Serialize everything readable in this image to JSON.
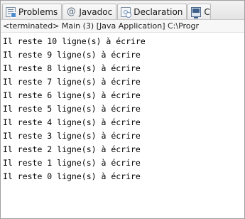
{
  "tabs": [
    {
      "label": "Problems",
      "icon": "problems-icon"
    },
    {
      "label": "Javadoc",
      "icon": "javadoc-icon"
    },
    {
      "label": "Declaration",
      "icon": "declaration-icon"
    },
    {
      "label": "C",
      "icon": "console-icon"
    }
  ],
  "status_text": "<terminated> Main (3) [Java Application] C:\\Progr",
  "console_lines": [
    "Il reste 10 ligne(s) à écrire",
    "Il reste 9 ligne(s) à écrire",
    "Il reste 8 ligne(s) à écrire",
    "Il reste 7 ligne(s) à écrire",
    "Il reste 6 ligne(s) à écrire",
    "Il reste 5 ligne(s) à écrire",
    "Il reste 4 ligne(s) à écrire",
    "Il reste 3 ligne(s) à écrire",
    "Il reste 2 ligne(s) à écrire",
    "Il reste 1 ligne(s) à écrire",
    "Il reste 0 ligne(s) à écrire"
  ]
}
